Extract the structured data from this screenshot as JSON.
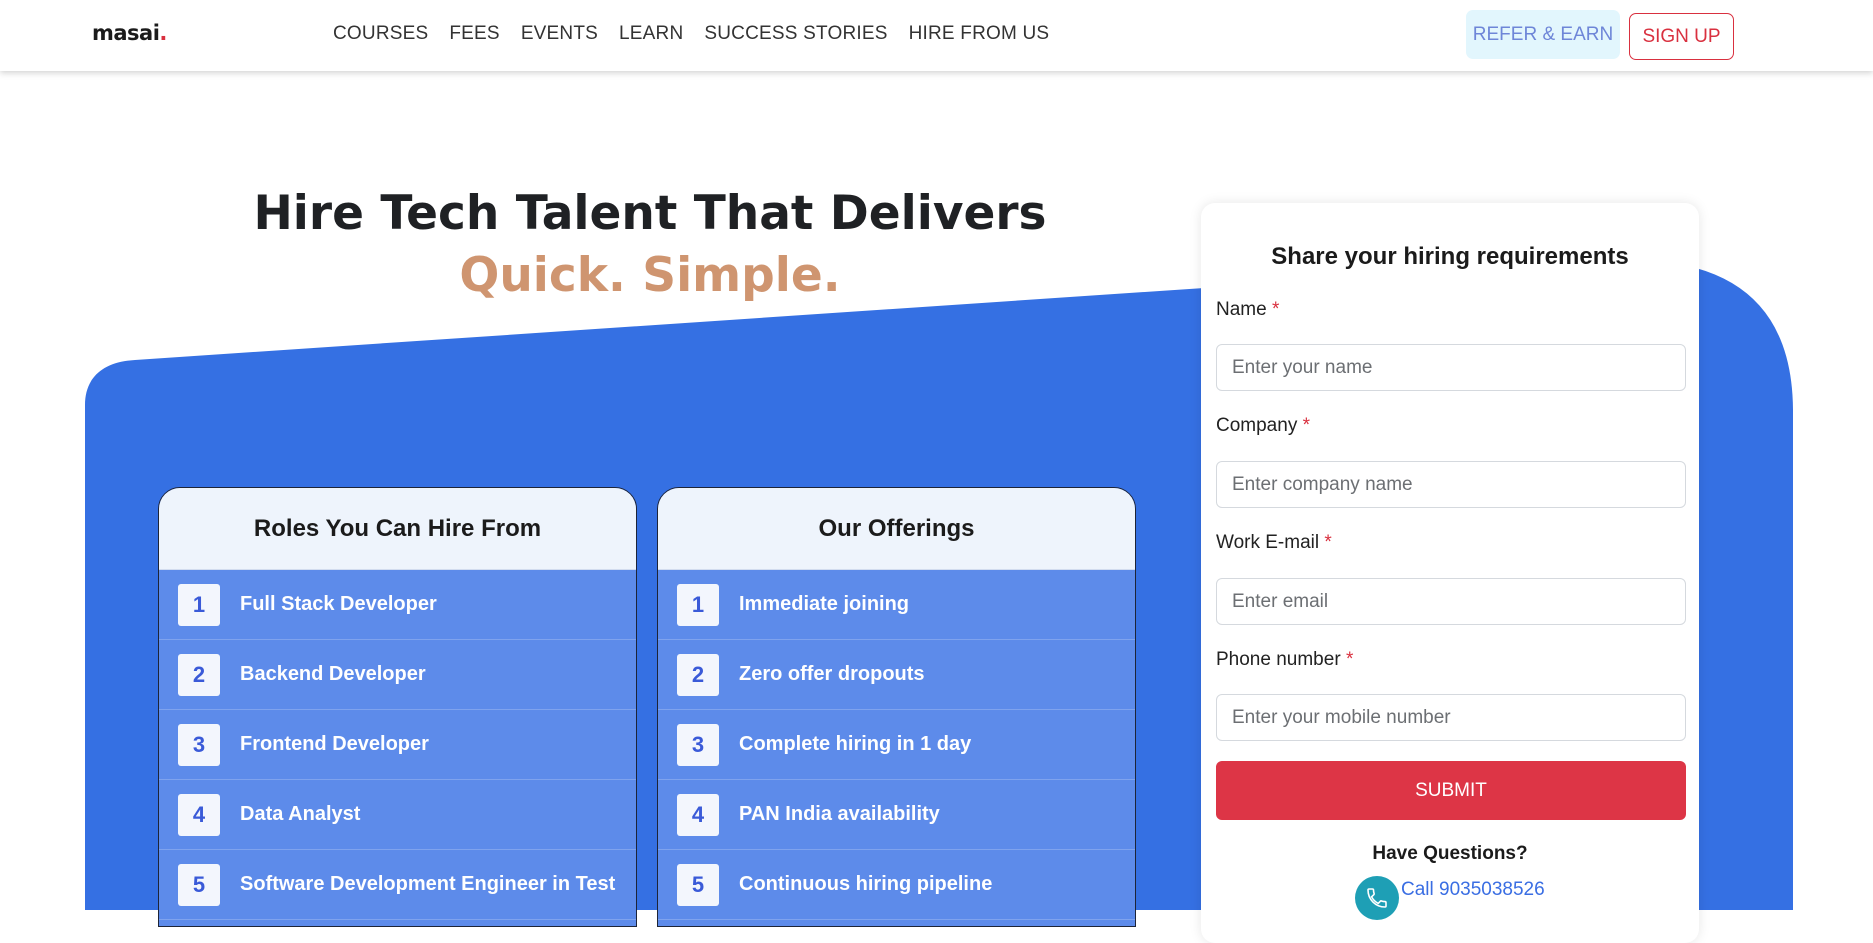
{
  "header": {
    "logo": {
      "text": "masai",
      "dot": "."
    },
    "nav": [
      "COURSES",
      "FEES",
      "EVENTS",
      "LEARN",
      "SUCCESS STORIES",
      "HIRE FROM US"
    ],
    "refer_label": "REFER & EARN",
    "signup_label": "SIGN UP"
  },
  "hero": {
    "title": "Hire Tech Talent That Delivers",
    "subtitle": "Quick. Simple."
  },
  "roles_card": {
    "title": "Roles You Can Hire From",
    "items": [
      {
        "num": "1",
        "label": "Full Stack Developer"
      },
      {
        "num": "2",
        "label": "Backend Developer"
      },
      {
        "num": "3",
        "label": "Frontend Developer"
      },
      {
        "num": "4",
        "label": "Data Analyst"
      },
      {
        "num": "5",
        "label": "Software Development Engineer in Test"
      }
    ]
  },
  "offerings_card": {
    "title": "Our Offerings",
    "items": [
      {
        "num": "1",
        "label": "Immediate joining"
      },
      {
        "num": "2",
        "label": "Zero offer dropouts"
      },
      {
        "num": "3",
        "label": "Complete hiring in 1 day"
      },
      {
        "num": "4",
        "label": "PAN India availability"
      },
      {
        "num": "5",
        "label": "Continuous hiring pipeline"
      }
    ]
  },
  "form": {
    "title": "Share your hiring requirements",
    "required_mark": "*",
    "fields": {
      "name": {
        "label": "Name",
        "placeholder": "Enter your name"
      },
      "company": {
        "label": "Company",
        "placeholder": "Enter company name"
      },
      "email": {
        "label": "Work E-mail",
        "placeholder": "Enter email"
      },
      "phone": {
        "label": "Phone number",
        "placeholder": "Enter your mobile number"
      }
    },
    "submit_label": "SUBMIT",
    "questions_label": "Have Questions?",
    "call_label": "Call 9035038526"
  },
  "colors": {
    "brand_blue": "#3570e3",
    "accent_red": "#d9303f",
    "accent_tan": "#cf9570",
    "refer_bg": "#e2f6fd"
  },
  "icons": [
    "phone-icon"
  ]
}
